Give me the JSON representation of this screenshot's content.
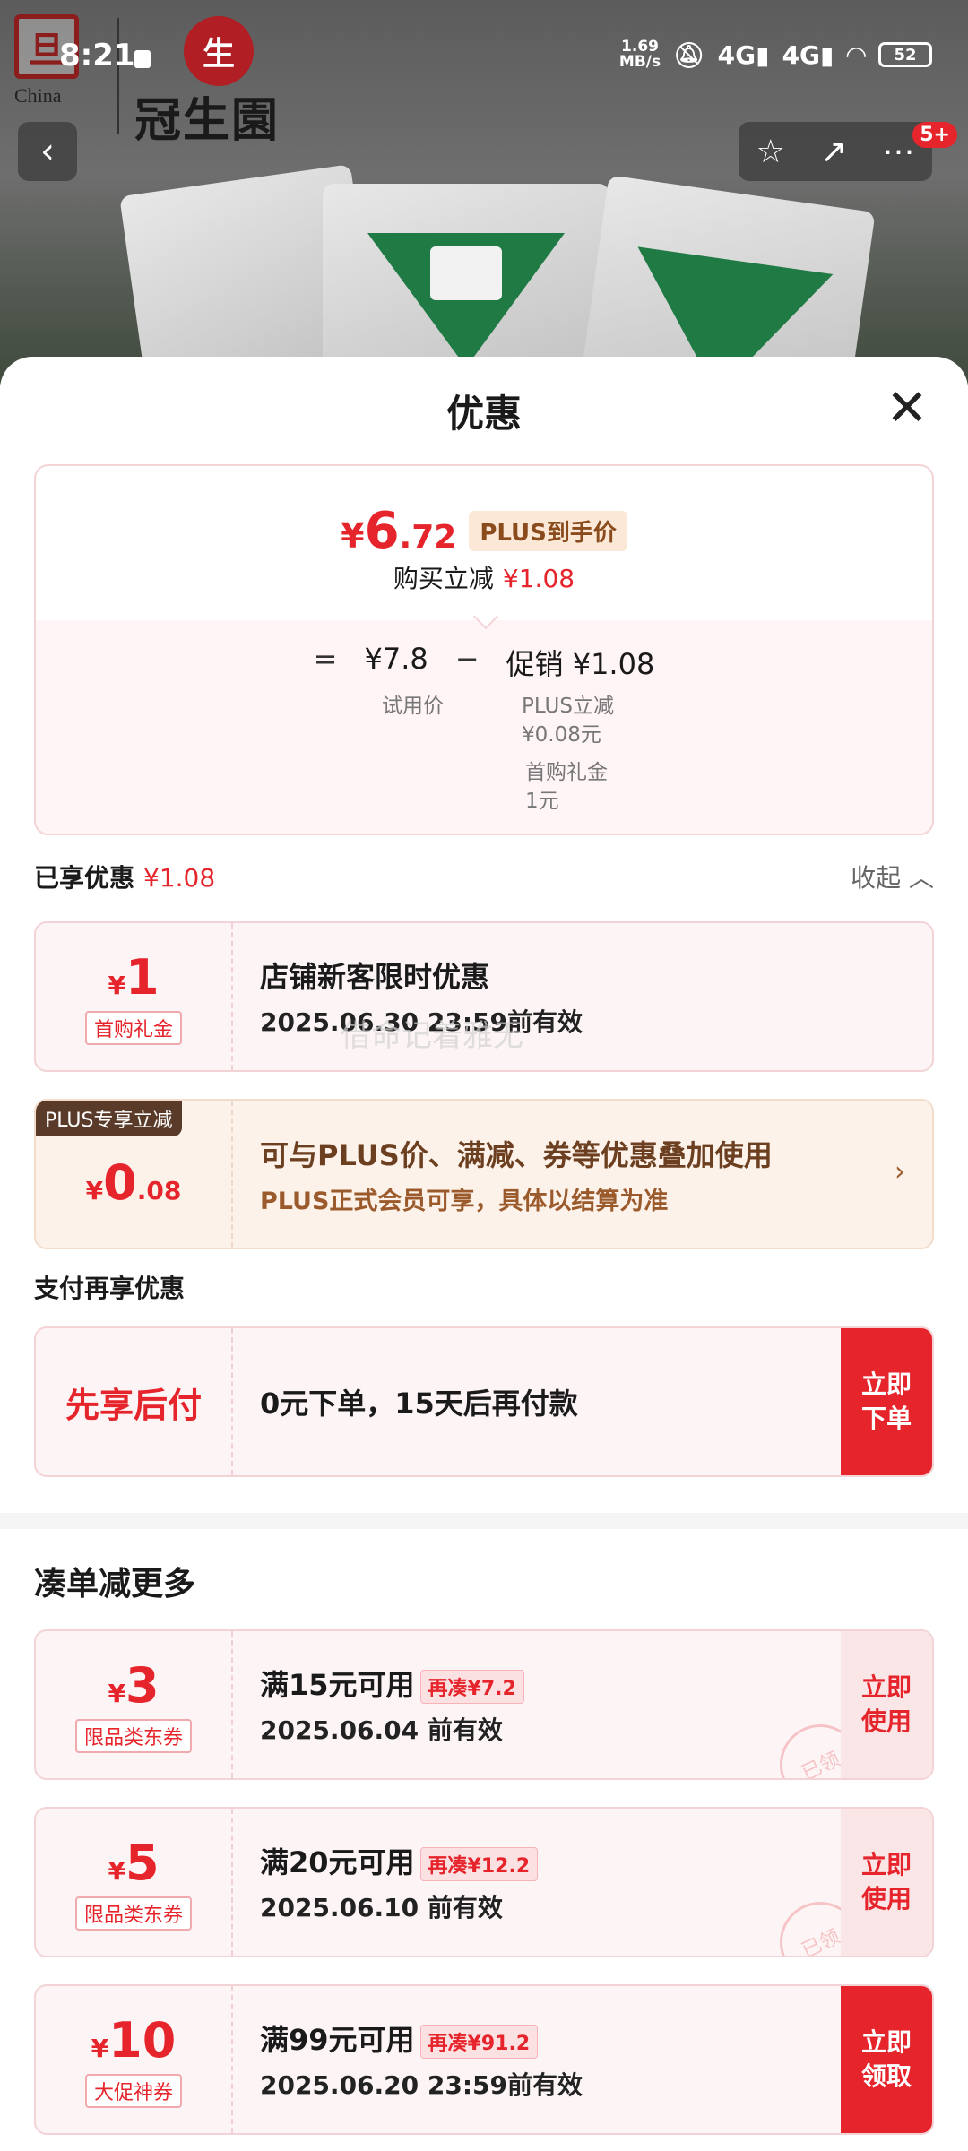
{
  "status_bar": {
    "time": "8:21",
    "net_speed_value": "1.69",
    "net_speed_unit": "MB/s",
    "signal1": "4G",
    "signal2": "4G",
    "battery": "52"
  },
  "brand": {
    "seal_char": "旦",
    "country": "China",
    "logo_char": "生",
    "name": "冠生園"
  },
  "nav": {
    "back_icon": "chevron-left-icon",
    "star_icon": "star-icon",
    "share_icon": "share-icon",
    "more_icon": "more-icon",
    "badge": "5+"
  },
  "sheet": {
    "title": "优惠",
    "close": "✕"
  },
  "price_card": {
    "yen": "¥",
    "price_int": "6",
    "price_dec": ".72",
    "plus_tag": "PLUS到手价",
    "buy_reduce_label": "购买立减",
    "buy_reduce_value": "¥1.08",
    "eq": "=",
    "trial_price": "¥7.8",
    "minus": "−",
    "promo": "促销 ¥1.08",
    "trial_label": "试用价",
    "plus_reduce_label": "PLUS立减",
    "plus_reduce_value": "¥0.08元",
    "first_gift_label": "首购礼金",
    "first_gift_value": "1元"
  },
  "enjoyed": {
    "label": "已享优惠",
    "value": "¥1.08",
    "collapse": "收起 ︿"
  },
  "coupons": [
    {
      "yen": "¥",
      "amount": "1",
      "tag": "首购礼金",
      "title": "店铺新客限时优惠",
      "validity": "2025.06.30 23:59前有效"
    }
  ],
  "plus_card": {
    "corner": "PLUS专享立减",
    "yen": "¥",
    "amount_int": "0",
    "amount_dec": ".08",
    "title": "可与PLUS价、满减、券等优惠叠加使用",
    "sub": "PLUS正式会员可享，具体以结算为准",
    "chevron": "›"
  },
  "pay_section": {
    "label": "支付再享优惠",
    "left_text": "先享后付",
    "title": "0元下单，15天后再付款",
    "button": "立即\n下单"
  },
  "more_section": {
    "title": "凑单减更多",
    "items": [
      {
        "yen": "¥",
        "amount": "3",
        "tag": "限品类东券",
        "title": "满15元可用",
        "chip": "再凑¥7.2",
        "validity": "2025.06.04 前有效",
        "button": "立即\n使用",
        "stamp": "已领"
      },
      {
        "yen": "¥",
        "amount": "5",
        "tag": "限品类东券",
        "title": "满20元可用",
        "chip": "再凑¥12.2",
        "validity": "2025.06.10 前有效",
        "button": "立即\n使用",
        "stamp": "已领"
      },
      {
        "yen": "¥",
        "amount": "10",
        "tag": "大促神券",
        "title": "满99元可用",
        "chip": "再凑¥91.2",
        "validity": "2025.06.20 23:59前有效",
        "button": "立即\n领取"
      }
    ]
  },
  "watermark": "借命记着雅无",
  "colors": {
    "accent": "#e5242b",
    "plus_brown": "#6b3f1f",
    "coupon_bg": "#fdf5f5"
  }
}
